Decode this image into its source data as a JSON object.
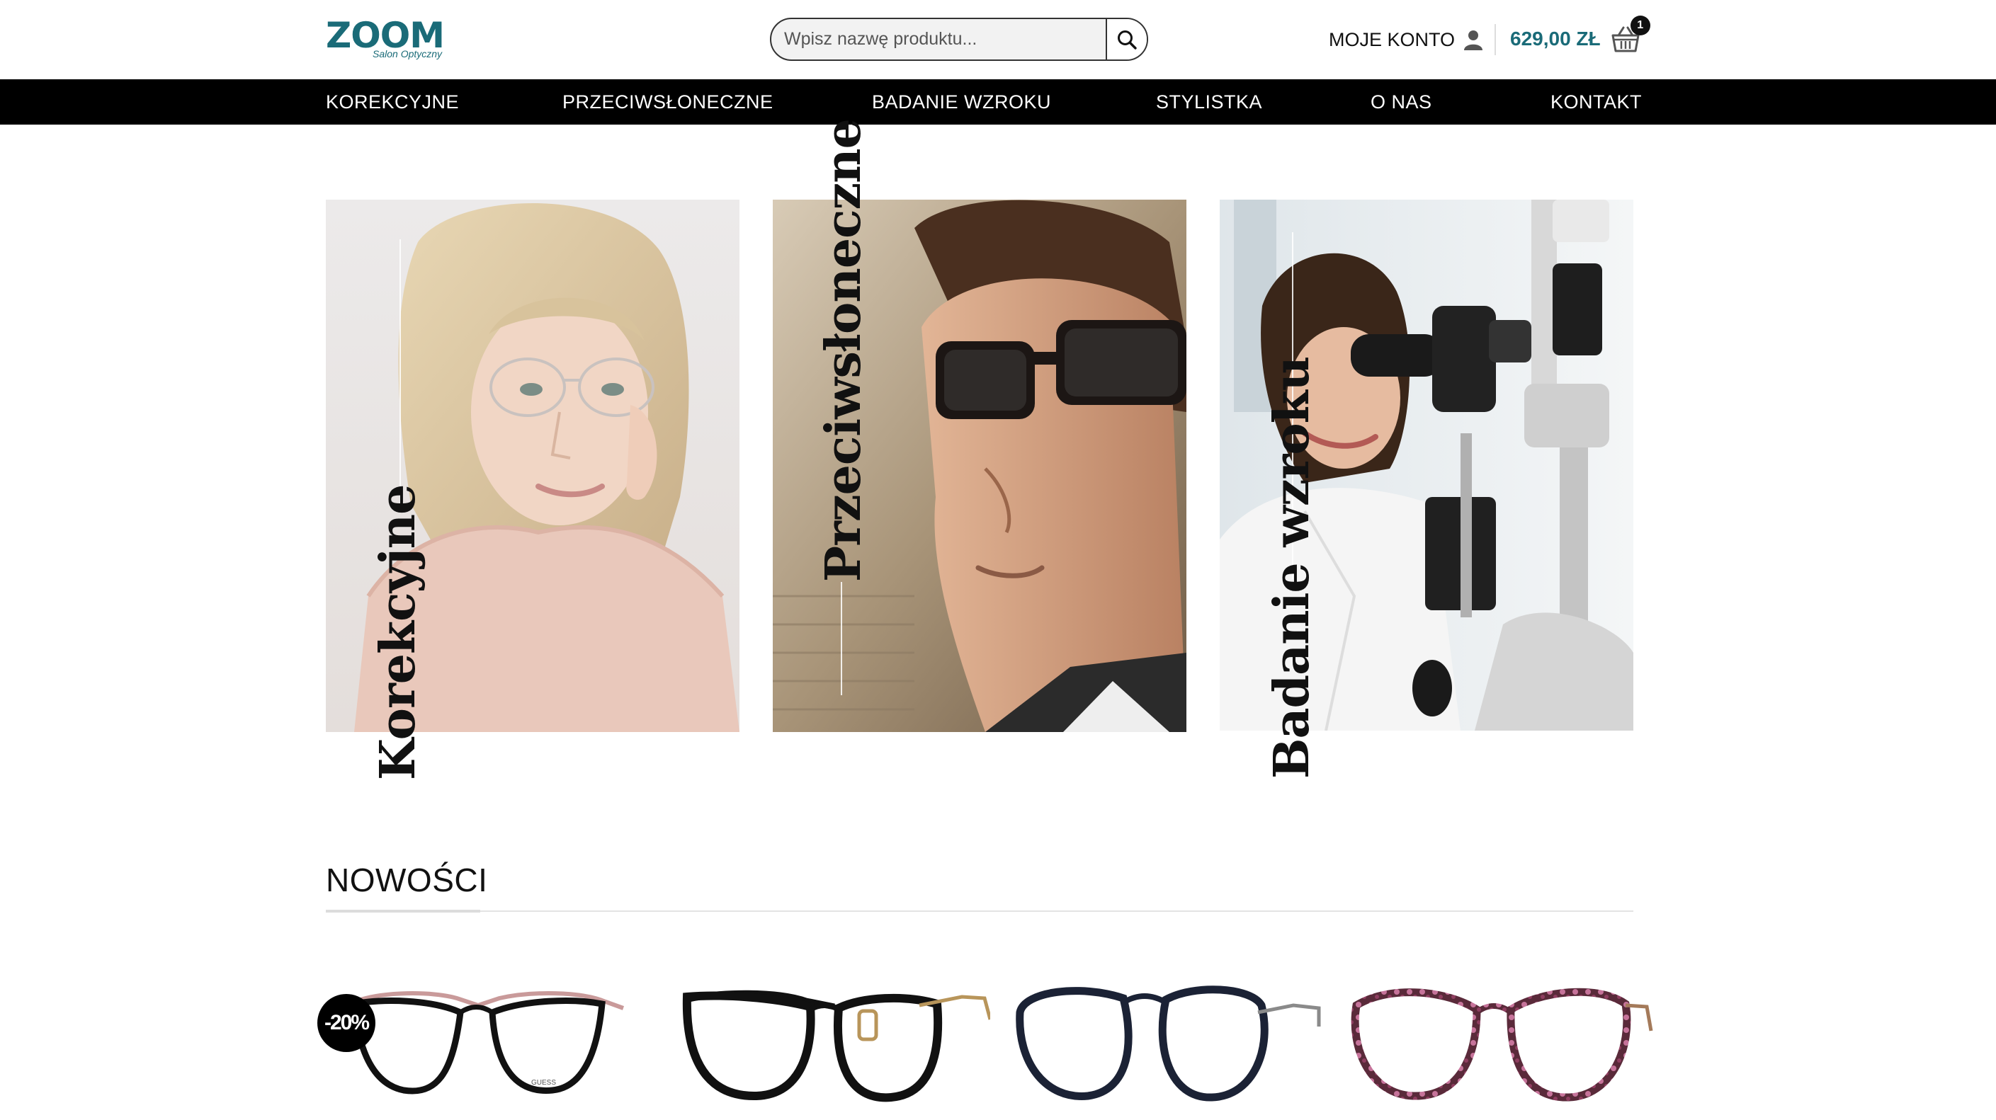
{
  "header": {
    "logo_text": "ZOOM",
    "logo_subtitle": "Salon Optyczny",
    "search_placeholder": "Wpisz nazwę produktu...",
    "account_label": "MOJE KONTO",
    "cart_total": "629,00 ZŁ",
    "cart_count": "1"
  },
  "nav": {
    "items": [
      "KOREKCYJNE",
      "PRZECIWSŁONECZNE",
      "BADANIE WZROKU",
      "STYLISTKA",
      "O NAS",
      "KONTAKT"
    ]
  },
  "categories": [
    {
      "label": "Korekcyjne"
    },
    {
      "label": "Przeciwsłoneczne"
    },
    {
      "label": "Badanie wzroku"
    }
  ],
  "new_section": {
    "title": "NOWOŚCI"
  },
  "products": [
    {
      "badge": "-20%",
      "frame_color": "#111111",
      "accent_color": "#c99a9a"
    },
    {
      "badge": "",
      "frame_color": "#111111",
      "accent_color": "#b8955a"
    },
    {
      "badge": "",
      "frame_color": "#1b2235",
      "accent_color": "#8a8a8a"
    },
    {
      "badge": "",
      "frame_color": "#5a2a3a",
      "accent_color": "#a47a5a"
    }
  ],
  "colors": {
    "brand": "#1a6b78",
    "nav_bg": "#000000",
    "badge_bg": "#000000"
  },
  "icons": {
    "search": "search-icon",
    "account": "user-icon",
    "cart": "basket-icon"
  }
}
